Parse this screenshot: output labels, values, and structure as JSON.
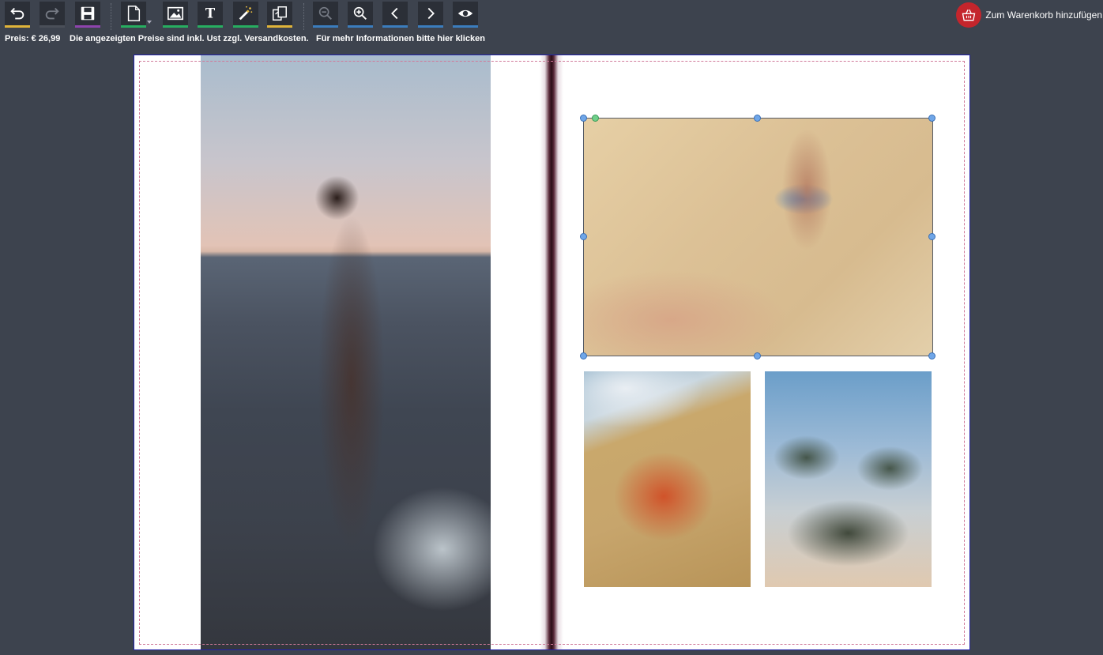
{
  "toolbar": {
    "buttons": [
      {
        "name": "undo",
        "icon": "undo-icon",
        "underline": "#e0b43a"
      },
      {
        "name": "redo",
        "icon": "redo-icon",
        "underline": "#4a4f58"
      },
      {
        "name": "save",
        "icon": "save-icon",
        "underline": "#8e44ad"
      },
      {
        "name": "page",
        "icon": "page-icon",
        "underline": "#27ae60"
      },
      {
        "name": "image",
        "icon": "image-icon",
        "underline": "#27ae60"
      },
      {
        "name": "text",
        "icon": "text-icon",
        "underline": "#27ae60"
      },
      {
        "name": "magic",
        "icon": "magic-wand-icon",
        "underline": "#27ae60"
      },
      {
        "name": "pages",
        "icon": "copy-pages-icon",
        "underline": "#e0b43a"
      },
      {
        "name": "zoom-out",
        "icon": "zoom-out-icon",
        "underline": "#3b7dbd"
      },
      {
        "name": "zoom-in",
        "icon": "zoom-in-icon",
        "underline": "#3b7dbd"
      },
      {
        "name": "prev",
        "icon": "chevron-left-icon",
        "underline": "#3b7dbd"
      },
      {
        "name": "next",
        "icon": "chevron-right-icon",
        "underline": "#3b7dbd"
      },
      {
        "name": "preview",
        "icon": "eye-icon",
        "underline": "#3b7dbd"
      }
    ],
    "price": "Preis: € 26,99",
    "price_note": "Die angezeigten Preise sind inkl. Ust zzgl. Versandkosten.",
    "more_info": "Für mehr Informationen bitte hier klicken",
    "cart_label": "Zum Warenkorb hinzufügen",
    "cart_color": "#c4252c"
  },
  "canvas": {
    "background": "#3d434e",
    "border_color": "#2222aa",
    "bleed_color": "#d07a9a",
    "photos": [
      {
        "name": "woman-in-sea-photo"
      },
      {
        "name": "beach-hands-photo",
        "selected": true
      },
      {
        "name": "starfish-photo"
      },
      {
        "name": "palm-trees-photo"
      }
    ]
  }
}
